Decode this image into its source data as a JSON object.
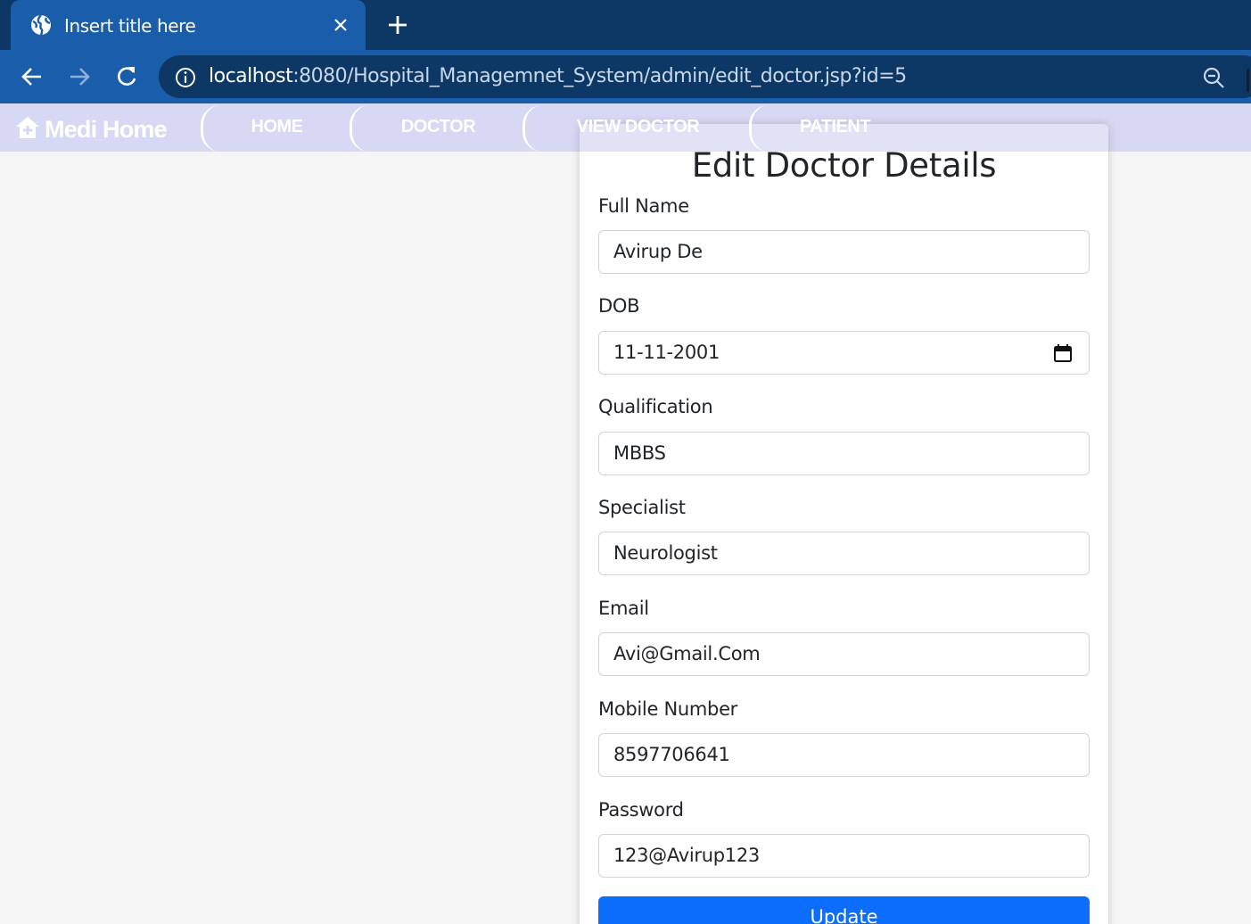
{
  "browser": {
    "tab_title": "Insert title here",
    "url_host": "localhost",
    "url_path": ":8080/Hospital_Managemnet_System/admin/edit_doctor.jsp?id=5"
  },
  "site_nav": {
    "brand": "Medi Home",
    "links": [
      "HOME",
      "DOCTOR",
      "VIEW DOCTOR",
      "PATIENT"
    ]
  },
  "form": {
    "title": "Edit Doctor Details",
    "fields": [
      {
        "label": "Full Name",
        "value": "Avirup De"
      },
      {
        "label": "DOB",
        "value": "11-11-2001"
      },
      {
        "label": "Qualification",
        "value": "MBBS"
      },
      {
        "label": "Specialist",
        "value": "Neurologist"
      },
      {
        "label": "Email",
        "value": "Avi@Gmail.Com"
      },
      {
        "label": "Mobile Number",
        "value": "8597706641"
      },
      {
        "label": "Password",
        "value": "123@Avirup123"
      }
    ],
    "submit_label": "Update"
  },
  "colors": {
    "chrome_dark": "#0d3764",
    "chrome_tab": "#1a5dab",
    "nav_bg": "#d7d8f3",
    "primary": "#0d6efd",
    "page_bg": "#f5f5f5"
  }
}
